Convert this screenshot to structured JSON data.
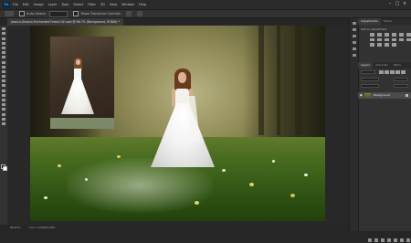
{
  "menubar": {
    "app_icon": "Ps",
    "items": [
      "File",
      "Edit",
      "Image",
      "Layer",
      "Type",
      "Select",
      "Filter",
      "3D",
      "View",
      "Window",
      "Help"
    ],
    "window_controls": [
      "minimize-icon",
      "maximize-icon",
      "close-icon"
    ]
  },
  "options": {
    "auto_select_label": "Auto-Select:",
    "transform_label": "Show Transform Controls"
  },
  "document": {
    "tab_title": "Jessica-Drossin-Enchanted-Forest-Girl.psd @ 66.7% (Background, RGB/8) *",
    "status": [
      "66.67%",
      "Doc: 5.93M/5.93M"
    ]
  },
  "panels": {
    "top_tabs": [
      "Adjustments",
      "Styles"
    ],
    "add_adjustment_label": "Add an adjustment",
    "layers_tabs": [
      "Layers",
      "Channels",
      "Paths"
    ],
    "layer_name": "Background"
  },
  "colors": {
    "accent": "#31a8ff",
    "panel_bg": "#323232",
    "app_bg": "#262626"
  }
}
